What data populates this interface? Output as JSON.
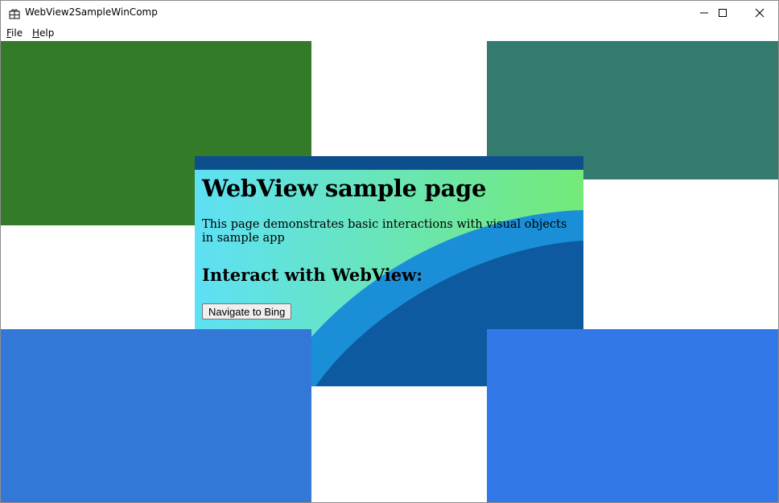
{
  "window": {
    "title": "WebView2SampleWinComp",
    "icon": "app-grid-icon",
    "controls": [
      "minimize-icon",
      "maximize-icon",
      "close-icon"
    ]
  },
  "menu": {
    "items": [
      {
        "label": "File",
        "mnemonic": "F",
        "rest": "ile"
      },
      {
        "label": "Help",
        "mnemonic": "H",
        "rest": "elp"
      }
    ]
  },
  "visuals": {
    "colors": {
      "top_left": "#337b28",
      "top_right": "#337b6e",
      "bottom_left": "#3378d6",
      "bottom_right": "#3378e8"
    }
  },
  "webview": {
    "page_title": "WebView sample page",
    "description": "This page demonstrates basic interactions with visual objects in sample app",
    "section_heading": "Interact with WebView:",
    "navigate_button": "Navigate to Bing",
    "colors": {
      "top_bar": "#0d4f8c",
      "gradient_start": "#5ee0f5",
      "gradient_end": "#74ea78",
      "wave_light": "#1a8fd8",
      "wave_dark": "#0d5aa0"
    }
  }
}
